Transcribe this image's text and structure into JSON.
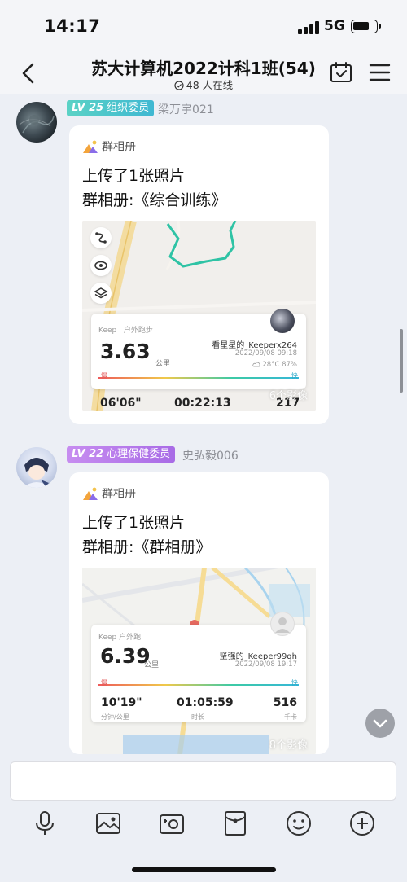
{
  "status": {
    "time": "14:17",
    "network": "5G"
  },
  "header": {
    "title": "苏大计算机2022计科1班(54)",
    "online": "48 人在线"
  },
  "messages": [
    {
      "level": "LV 25",
      "role": "组织委员",
      "sender": "梁万宇021",
      "album_tag": "群相册",
      "line1": "上传了1张照片",
      "line2": "群相册:《综合训练》",
      "photo": {
        "activity": "Keep · 户外跑步",
        "distance": "3.63",
        "unit": "公里",
        "user": "看星星的_Keeperx264",
        "datetime": "2022/09/08 09:18",
        "weather": "28°C  87%",
        "slow": "慢",
        "fast": "快",
        "pace": "06'06\"",
        "duration": "00:22:13",
        "calories": "217",
        "overlay": "6个影像"
      }
    },
    {
      "level": "LV 22",
      "role": "心理保健委员",
      "sender": "史弘毅006",
      "album_tag": "群相册",
      "line1": "上传了1张照片",
      "line2": "群相册:《群相册》",
      "photo": {
        "activity": "Keep 户外跑",
        "distance": "6.39",
        "unit": "公里",
        "user": "坚强的_Keeper99qh",
        "datetime": "2022/09/08 19:17",
        "slow": "慢",
        "fast": "快",
        "pace": "10'19\"",
        "pace_label": "分钟/公里",
        "duration": "01:05:59",
        "duration_label": "时长",
        "calories": "516",
        "calories_label": "千卡",
        "overlay": "8个影像"
      }
    }
  ],
  "toolbar_icons": [
    "microphone-icon",
    "image-icon",
    "camera-icon",
    "red-packet-icon",
    "emoji-icon",
    "plus-icon"
  ]
}
